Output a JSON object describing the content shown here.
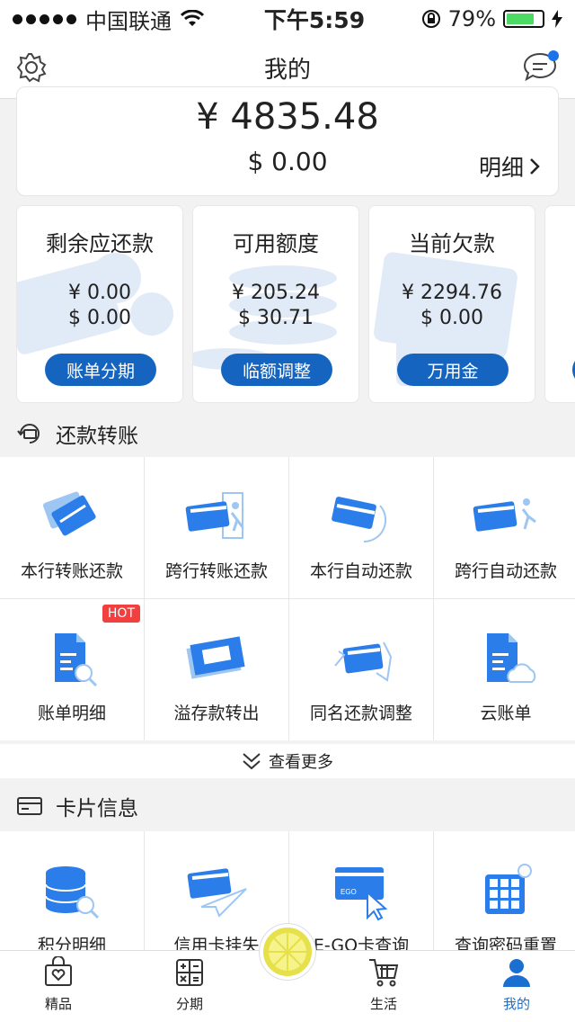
{
  "status_bar": {
    "carrier": "中国联通",
    "time": "下午5:59",
    "battery_pct": "79%",
    "battery_level": 0.79
  },
  "nav": {
    "title": "我的",
    "settings_icon": "gear-icon",
    "message_icon": "chat-bubble-icon"
  },
  "balance": {
    "cny": "¥ 4835.48",
    "usd": "$ 0.00",
    "detail_label": "明细"
  },
  "stats": [
    {
      "title": "剩余应还款",
      "cny": "¥ 0.00",
      "usd": "$ 0.00",
      "button": "账单分期"
    },
    {
      "title": "可用额度",
      "cny": "¥ 205.24",
      "usd": "$ 30.71",
      "button": "临额调整"
    },
    {
      "title": "当前欠款",
      "cny": "¥ 2294.76",
      "usd": "$ 0.00",
      "button": "万用金"
    }
  ],
  "repay_section": {
    "title": "还款转账",
    "items": [
      {
        "label": "本行转账还款",
        "icon": "cards-transfer-icon"
      },
      {
        "label": "跨行转账还款",
        "icon": "card-door-runner-icon"
      },
      {
        "label": "本行自动还款",
        "icon": "card-auto-cycle-icon"
      },
      {
        "label": "跨行自动还款",
        "icon": "card-runner-icon"
      },
      {
        "label": "账单明细",
        "icon": "document-search-icon",
        "badge": "HOT"
      },
      {
        "label": "溢存款转出",
        "icon": "cash-stack-icon"
      },
      {
        "label": "同名还款调整",
        "icon": "card-hand-icon"
      },
      {
        "label": "云账单",
        "icon": "document-cloud-icon"
      }
    ],
    "more_label": "查看更多"
  },
  "card_section": {
    "title": "卡片信息",
    "items": [
      {
        "label": "积分明细",
        "icon": "database-search-icon"
      },
      {
        "label": "信用卡挂失",
        "icon": "card-paper-plane-icon"
      },
      {
        "label": "E-GO卡查询",
        "icon": "card-cursor-icon",
        "card_text": "EGO"
      },
      {
        "label": "查询密码重置",
        "icon": "keypad-gear-icon"
      }
    ]
  },
  "tabs": [
    {
      "label": "精品",
      "icon": "gift-bag-icon"
    },
    {
      "label": "分期",
      "icon": "calculator-icon"
    },
    {
      "label": "生活",
      "icon": "shopping-cart-icon"
    },
    {
      "label": "我的",
      "icon": "user-icon",
      "active": true
    }
  ],
  "colors": {
    "accent": "#1565c0",
    "icon_blue": "#2b7de9",
    "hot": "#f04040",
    "battery": "#4cd964"
  }
}
